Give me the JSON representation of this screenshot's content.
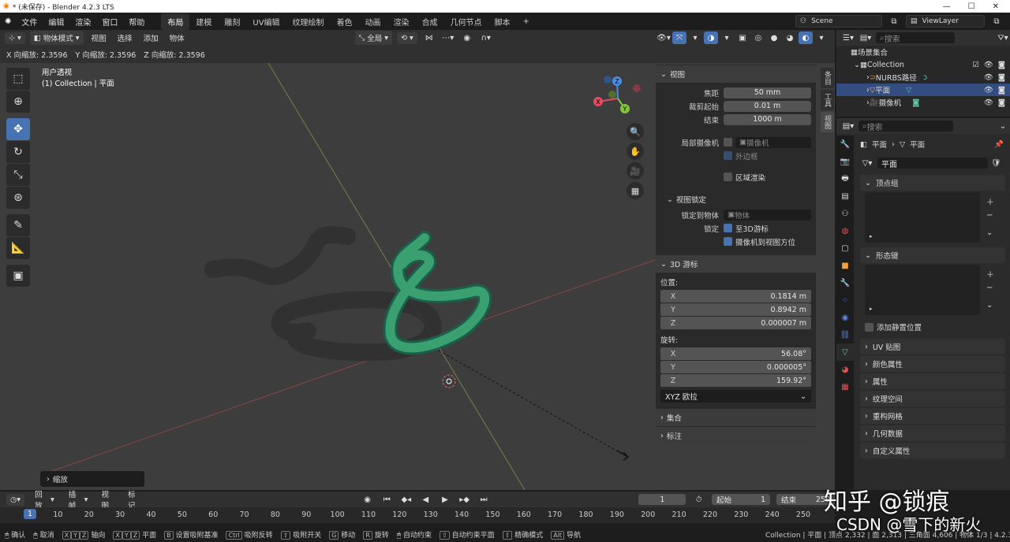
{
  "window": {
    "title": "* (未保存) - Blender 4.2.3 LTS",
    "controls": [
      "—",
      "☐",
      "✕"
    ]
  },
  "menu": {
    "items": [
      "文件",
      "编辑",
      "渲染",
      "窗口",
      "帮助"
    ],
    "workspaces": [
      "布局",
      "建模",
      "雕刻",
      "UV编辑",
      "纹理绘制",
      "着色",
      "动画",
      "渲染",
      "合成",
      "几何节点",
      "脚本"
    ],
    "active_ws": "布局",
    "add": "+",
    "scene": "Scene",
    "view_layer": "ViewLayer"
  },
  "viewport_header": {
    "mode": "物体模式",
    "menus": [
      "视图",
      "选择",
      "添加",
      "物体"
    ],
    "transform": "全局"
  },
  "operator_info": [
    "X 向缩放: 2.3596",
    "Y 向缩放: 2.3596",
    "Z 向缩放: 2.3596"
  ],
  "viewport": {
    "line1": "用户透视",
    "line2": "(1) Collection | 平面"
  },
  "gizmo": {
    "x": "X",
    "y": "Y",
    "z": "Z",
    "colors": {
      "x": "#e44c5f",
      "y": "#85c341",
      "z": "#4a8ee6"
    }
  },
  "npanel": {
    "view": {
      "title": "视图",
      "focal_label": "焦距",
      "focal": "50 mm",
      "clip_start_label": "裁剪起始",
      "clip_start": "0.01 m",
      "clip_end_label": "结束",
      "clip_end": "1000 m",
      "local_cam_label": "局部摄像机",
      "local_cam": "摄像机",
      "frame_label": "外边框",
      "region_label": "区域渲染"
    },
    "view_lock": {
      "title": "视图锁定",
      "lock_obj_label": "锁定到物体",
      "lock_obj": "物体",
      "lock_label": "锁定",
      "to_cursor": "至3D游标",
      "cam_to_view": "摄像机到视图方位"
    },
    "cursor": {
      "title": "3D 游标",
      "loc_label": "位置:",
      "loc": [
        {
          "a": "X",
          "v": "0.1814 m"
        },
        {
          "a": "Y",
          "v": "0.8942 m"
        },
        {
          "a": "Z",
          "v": "0.000007 m"
        }
      ],
      "rot_label": "旋转:",
      "rot": [
        {
          "a": "X",
          "v": "56.08°"
        },
        {
          "a": "Y",
          "v": "0.000005°"
        },
        {
          "a": "Z",
          "v": "159.92°"
        }
      ],
      "mode": "XYZ 欧拉"
    },
    "collection": "集合",
    "annotation": "标注",
    "tabs": [
      "条目",
      "工具",
      "视图"
    ]
  },
  "outliner": {
    "search": "搜索",
    "root": "场景集合",
    "items": [
      {
        "name": "Collection",
        "indent": 1
      },
      {
        "name": "NURBS路径",
        "indent": 2
      },
      {
        "name": "平面",
        "indent": 2,
        "sel": true
      },
      {
        "name": "摄像机",
        "indent": 2
      }
    ]
  },
  "props": {
    "search": "搜索",
    "crumb1": "平面",
    "crumb2": "平面",
    "mesh_name": "平面",
    "vertex_groups": "顶点组",
    "shape_keys": "形态键",
    "add_rest": "添加静置位置",
    "sections": [
      "UV 贴图",
      "颜色属性",
      "属性",
      "纹理空间",
      "重构网格",
      "几何数据",
      "自定义属性"
    ]
  },
  "zoom_popup": "缩放",
  "timeline": {
    "menus": [
      "回放",
      "插帧",
      "视图",
      "标记"
    ],
    "current": "1",
    "start_label": "起始",
    "start": "1",
    "end_label": "结束",
    "end": "250",
    "frames": [
      "1",
      "10",
      "20",
      "30",
      "40",
      "50",
      "60",
      "70",
      "80",
      "90",
      "100",
      "110",
      "120",
      "130",
      "140",
      "150",
      "160",
      "170",
      "180",
      "190",
      "200",
      "210",
      "220",
      "230",
      "240",
      "250"
    ]
  },
  "status": {
    "items": [
      "确认",
      "取消",
      "X",
      "Y",
      "Z",
      "轴向",
      "X",
      "Y",
      "Z",
      "平面",
      "B",
      "设置吸附基准",
      "Ctrl",
      "吸附反转",
      "吸附开关",
      "G",
      "移动",
      "R",
      "旋转",
      "自动约束",
      "自动约束平面",
      "精确模式",
      "Alt",
      "导航"
    ],
    "right": "Collection | 平面 | 顶点 2,332 | 面 2,313 | 三角面 4,606 | 物体 1/3 | 4.2.3"
  },
  "watermark": {
    "line1": "知乎 @锁痕",
    "line2": "CSDN @雪下的新火"
  }
}
